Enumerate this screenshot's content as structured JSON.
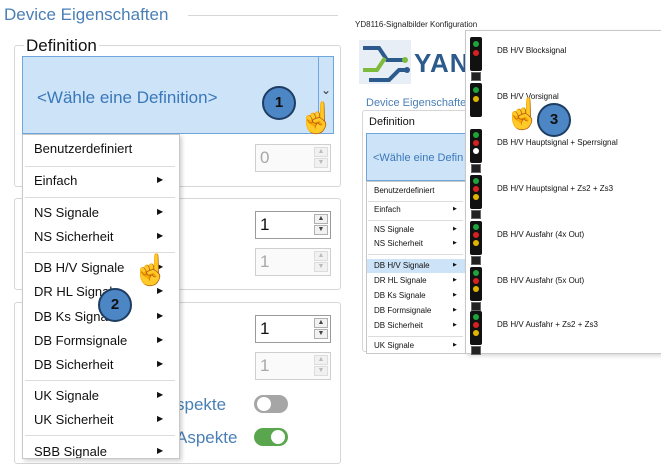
{
  "left_panel": {
    "title": "Device Eigenschaften",
    "definition_label": "Definition",
    "combo_text": "<Wähle eine Definition>",
    "spinners": [
      {
        "value": "0",
        "enabled": false
      },
      {
        "value": "1",
        "enabled": true
      },
      {
        "value": "1",
        "enabled": false
      },
      {
        "value": "1",
        "enabled": true
      },
      {
        "value": "1",
        "enabled": false
      }
    ],
    "aspekte": [
      {
        "text": "spekte",
        "on": false
      },
      {
        "text": "Aspekte",
        "on": true
      }
    ],
    "menu_items": [
      {
        "label": "Benutzerdefiniert",
        "submenu": false
      },
      {
        "label": "Einfach",
        "submenu": true
      },
      {
        "label": "NS Signale",
        "submenu": true
      },
      {
        "label": "NS Sicherheit",
        "submenu": true
      },
      {
        "label": "DB H/V Signale",
        "submenu": true
      },
      {
        "label": "DR HL Signale",
        "submenu": true
      },
      {
        "label": "DB Ks Signale",
        "submenu": true
      },
      {
        "label": "DB Formsignale",
        "submenu": true
      },
      {
        "label": "DB Sicherheit",
        "submenu": true
      },
      {
        "label": "UK Signale",
        "submenu": true
      },
      {
        "label": "UK Sicherheit",
        "submenu": true
      },
      {
        "label": "SBB Signale",
        "submenu": true
      }
    ]
  },
  "badges": [
    "1",
    "2",
    "3"
  ],
  "right_window": {
    "title": "YD8116-Signalbilder Konfiguration",
    "logo_text": "YAN",
    "device_label": "Device Eigenschaften",
    "definition_label": "Definition",
    "combo_text": "<Wähle eine Defin",
    "menu_items": [
      {
        "label": "Benutzerdefiniert",
        "submenu": false
      },
      {
        "label": "Einfach",
        "submenu": true
      },
      {
        "label": "NS Signale",
        "submenu": true
      },
      {
        "label": "NS Sicherheit",
        "submenu": true
      },
      {
        "label": "DB H/V Signale",
        "submenu": true,
        "highlight": true
      },
      {
        "label": "DR HL Signale",
        "submenu": true
      },
      {
        "label": "DB Ks Signale",
        "submenu": true
      },
      {
        "label": "DB Formsignale",
        "submenu": true
      },
      {
        "label": "DB Sicherheit",
        "submenu": true
      },
      {
        "label": "UK Signale",
        "submenu": true
      }
    ],
    "submenu_items": [
      {
        "label": "DB H/V Blocksignal",
        "lamps": [
          "#1fa33a",
          "#d92020"
        ]
      },
      {
        "label": "DB H/V Vorsignal",
        "lamps": [
          "#1fa33a",
          "#e0b400"
        ]
      },
      {
        "label": "DB H/V Hauptsignal + Sperrsignal",
        "lamps": [
          "#1fa33a",
          "#d92020",
          "#ffffff"
        ]
      },
      {
        "label": "DB H/V Hauptsignal + Zs2 + Zs3",
        "lamps": [
          "#1fa33a",
          "#d92020",
          "#e0b400"
        ]
      },
      {
        "label": "DB H/V Ausfahr (4x Out)",
        "lamps": [
          "#1fa33a",
          "#d92020",
          "#e0b400"
        ]
      },
      {
        "label": "DB H/V Ausfahr (5x Out)",
        "lamps": [
          "#1fa33a",
          "#d92020",
          "#e0b400"
        ]
      },
      {
        "label": "DB H/V Ausfahr + Zs2 + Zs3",
        "lamps": [
          "#1fa33a",
          "#d92020",
          "#e0b400"
        ]
      }
    ]
  },
  "colors": {
    "accent": "#4a7fb5",
    "combo_bg": "#cde3f7",
    "badge": "#4c86c4",
    "toggle_off": "#a6a6a6",
    "toggle_on": "#5aa64e"
  }
}
